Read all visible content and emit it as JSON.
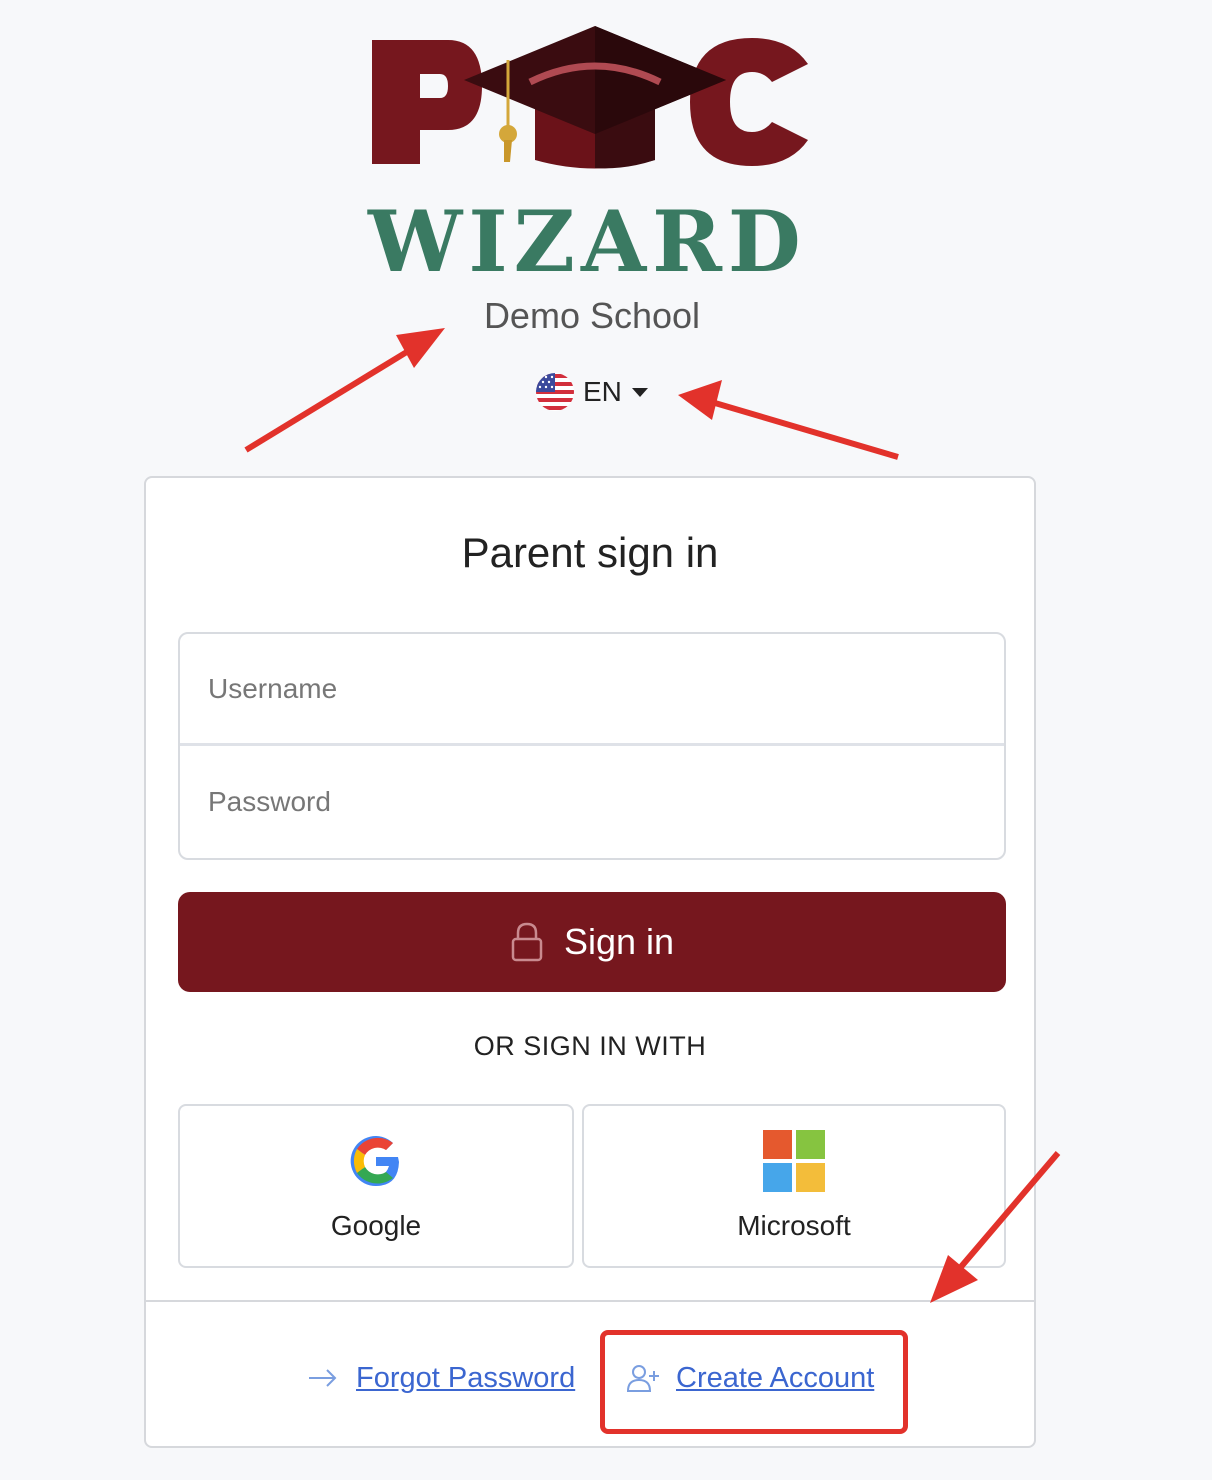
{
  "brand": {
    "logo_text": "WIZARD",
    "logo_letters": "PTC",
    "colors": {
      "maroon": "#76171e",
      "green": "#3a7a62"
    }
  },
  "school_name": "Demo School",
  "language": {
    "code": "EN",
    "flag_icon": "us-flag-icon"
  },
  "card": {
    "title": "Parent sign in",
    "username_placeholder": "Username",
    "password_placeholder": "Password",
    "signin_label": "Sign in",
    "or_label": "OR SIGN IN WITH",
    "sso": [
      {
        "label": "Google",
        "icon": "google-icon"
      },
      {
        "label": "Microsoft",
        "icon": "microsoft-icon"
      }
    ],
    "forgot_label": "Forgot Password",
    "create_label": "Create Account"
  },
  "annotation_color": "#e2322b"
}
